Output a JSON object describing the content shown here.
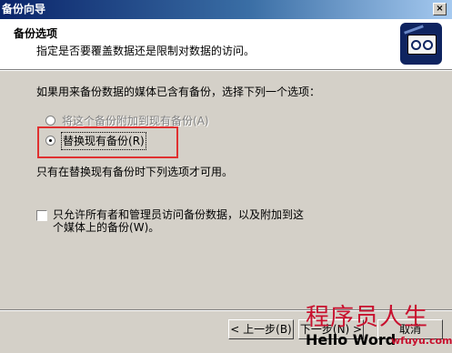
{
  "window": {
    "title": "备份向导"
  },
  "header": {
    "title": "备份选项",
    "subtitle": "指定是否要覆盖数据还是限制对数据的访问。",
    "icon": "backup-tape-icon"
  },
  "main": {
    "prompt": "如果用来备份数据的媒体已含有备份，选择下列一个选项：",
    "options": [
      {
        "label": "将这个备份附加到现有备份",
        "accel": "(A)",
        "selected": false
      },
      {
        "label": "替换现有备份",
        "accel": "(R)",
        "selected": true
      }
    ],
    "info": "只有在替换现有备份时下列选项才可用。",
    "checkbox": {
      "line1": "只允许所有者和管理员访问备份数据，以及附加到这",
      "line2": "个媒体上的备份",
      "accel": "(W)。",
      "checked": false
    }
  },
  "buttons": {
    "back": "< 上一步(B)",
    "next": "下一步(N) >",
    "cancel": "取消"
  },
  "watermark": {
    "cn": "程序员人生",
    "en": "Hello Word",
    "url": "wfuyu.com"
  },
  "colors": {
    "highlight_box": "#e03030",
    "title_bar": "#0a246a",
    "face": "#d4d0c8"
  }
}
